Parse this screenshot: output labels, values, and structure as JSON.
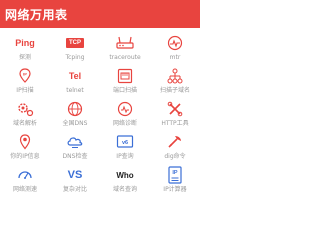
{
  "header": {
    "title": "网络万用表"
  },
  "tools": {
    "ping": {
      "icon_text": "Ping",
      "label": "探测",
      "icon": "ping-text-icon"
    },
    "tcping": {
      "icon_text": "TCP",
      "label": "Tcping",
      "icon": "tcp-badge-icon"
    },
    "traceroute": {
      "label": "traceroute",
      "icon": "router-icon"
    },
    "mtr": {
      "label": "mtr",
      "icon": "ping-circle-icon"
    },
    "ip_scan": {
      "label": "IP扫描",
      "icon": "location-pin-icon"
    },
    "telnet": {
      "icon_text": "Tel",
      "label": "telnet",
      "icon": "telnet-text-icon"
    },
    "port_scan": {
      "label": "端口扫描",
      "icon": "port-icon"
    },
    "subdomain_scan": {
      "label": "扫描子域名",
      "icon": "network-icon"
    },
    "dns_resolve": {
      "label": "域名解析",
      "icon": "gear-network-icon"
    },
    "global_dns": {
      "label": "全国DNS",
      "icon": "globe-icon"
    },
    "network_diag": {
      "label": "网络诊断",
      "icon": "diagnose-icon"
    },
    "http_tool": {
      "label": "HTTP工具",
      "icon": "tools-icon"
    },
    "my_ip": {
      "label": "你的IP信息",
      "icon": "ip-location-icon"
    },
    "dns_check": {
      "label": "DNS检查",
      "icon": "dns-cloud-icon"
    },
    "ip_query": {
      "label": "IP查询",
      "icon": "ipv6-icon"
    },
    "dig": {
      "label": "dig命令",
      "icon": "dig-icon"
    },
    "speed_test": {
      "label": "网络测速",
      "icon": "speedometer-icon"
    },
    "compare": {
      "icon_text": "VS",
      "label": "复杂对比",
      "icon": "vs-icon"
    },
    "whois": {
      "icon_text": "Who",
      "label": "域名查询",
      "icon": "whois-icon"
    },
    "ip_calc": {
      "icon_text": "IP",
      "label": "IP计算器",
      "icon": "ip-calculator-icon"
    }
  },
  "colors": {
    "accent": "#e8443f",
    "label": "#9a9a9a",
    "icon_blue": "#3b6fd6"
  }
}
